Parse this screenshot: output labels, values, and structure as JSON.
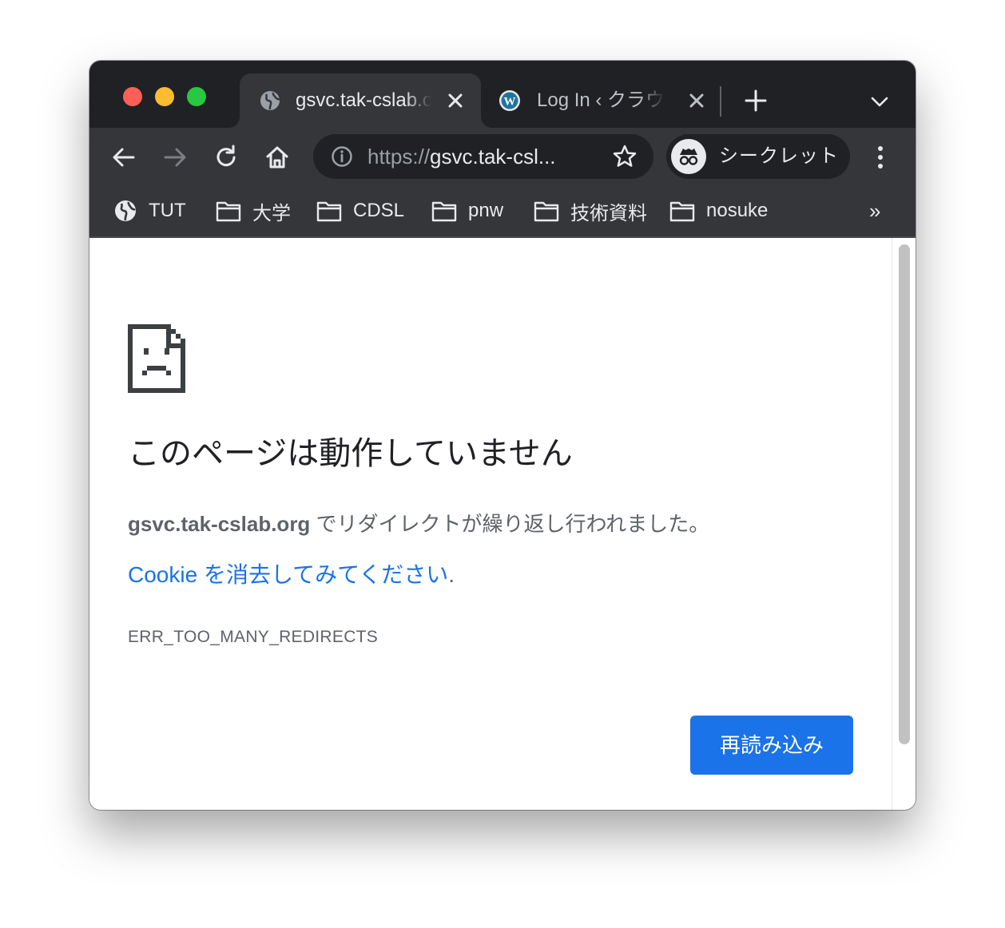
{
  "window": {
    "tabs": [
      {
        "title": "gsvc.tak-cslab.org",
        "active": true
      },
      {
        "title": "Log In ‹ クラウド",
        "active": false
      }
    ]
  },
  "toolbar": {
    "url_scheme": "https://",
    "url_host": "gsvc.tak-csl...",
    "incognito_label": "シークレット"
  },
  "bookmarks": [
    {
      "label": "TUT",
      "icon": "globe-icon"
    },
    {
      "label": "大学",
      "icon": "folder-icon"
    },
    {
      "label": "CDSL",
      "icon": "folder-icon"
    },
    {
      "label": "pnw",
      "icon": "folder-icon"
    },
    {
      "label": "技術資料",
      "icon": "folder-icon"
    },
    {
      "label": "nosuke",
      "icon": "folder-icon"
    }
  ],
  "bookmarks_more": "»",
  "error": {
    "title": "このページは動作していません",
    "host": "gsvc.tak-cslab.org",
    "message": " でリダイレクトが繰り返し行われました。",
    "suggestion_link": "Cookie を消去してみてください",
    "suggestion_suffix": ".",
    "code": "ERR_TOO_MANY_REDIRECTS",
    "reload_label": "再読み込み"
  },
  "colors": {
    "titlebar": "#202124",
    "toolbar": "#35363a",
    "accent": "#1a73e8",
    "text_secondary": "#5f6368"
  }
}
